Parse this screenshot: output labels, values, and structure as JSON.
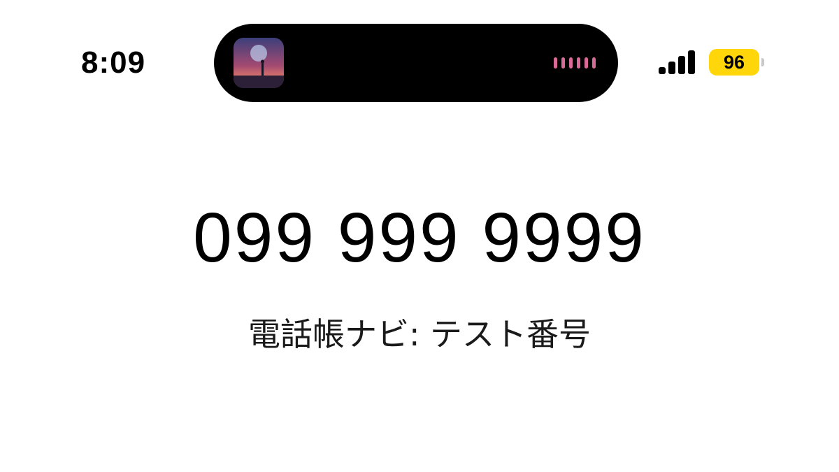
{
  "status_bar": {
    "time": "8:09",
    "battery_level": "96",
    "battery_color": "#ffd60a",
    "signal_bars": 4,
    "icons": [
      "album-art-icon",
      "waveform-icon",
      "signal-icon",
      "battery-icon"
    ]
  },
  "dynamic_island": {
    "waveform_color": "#d86a97"
  },
  "call": {
    "phone_number": "099 999 9999",
    "caller_label": "電話帳ナビ: テスト番号"
  }
}
